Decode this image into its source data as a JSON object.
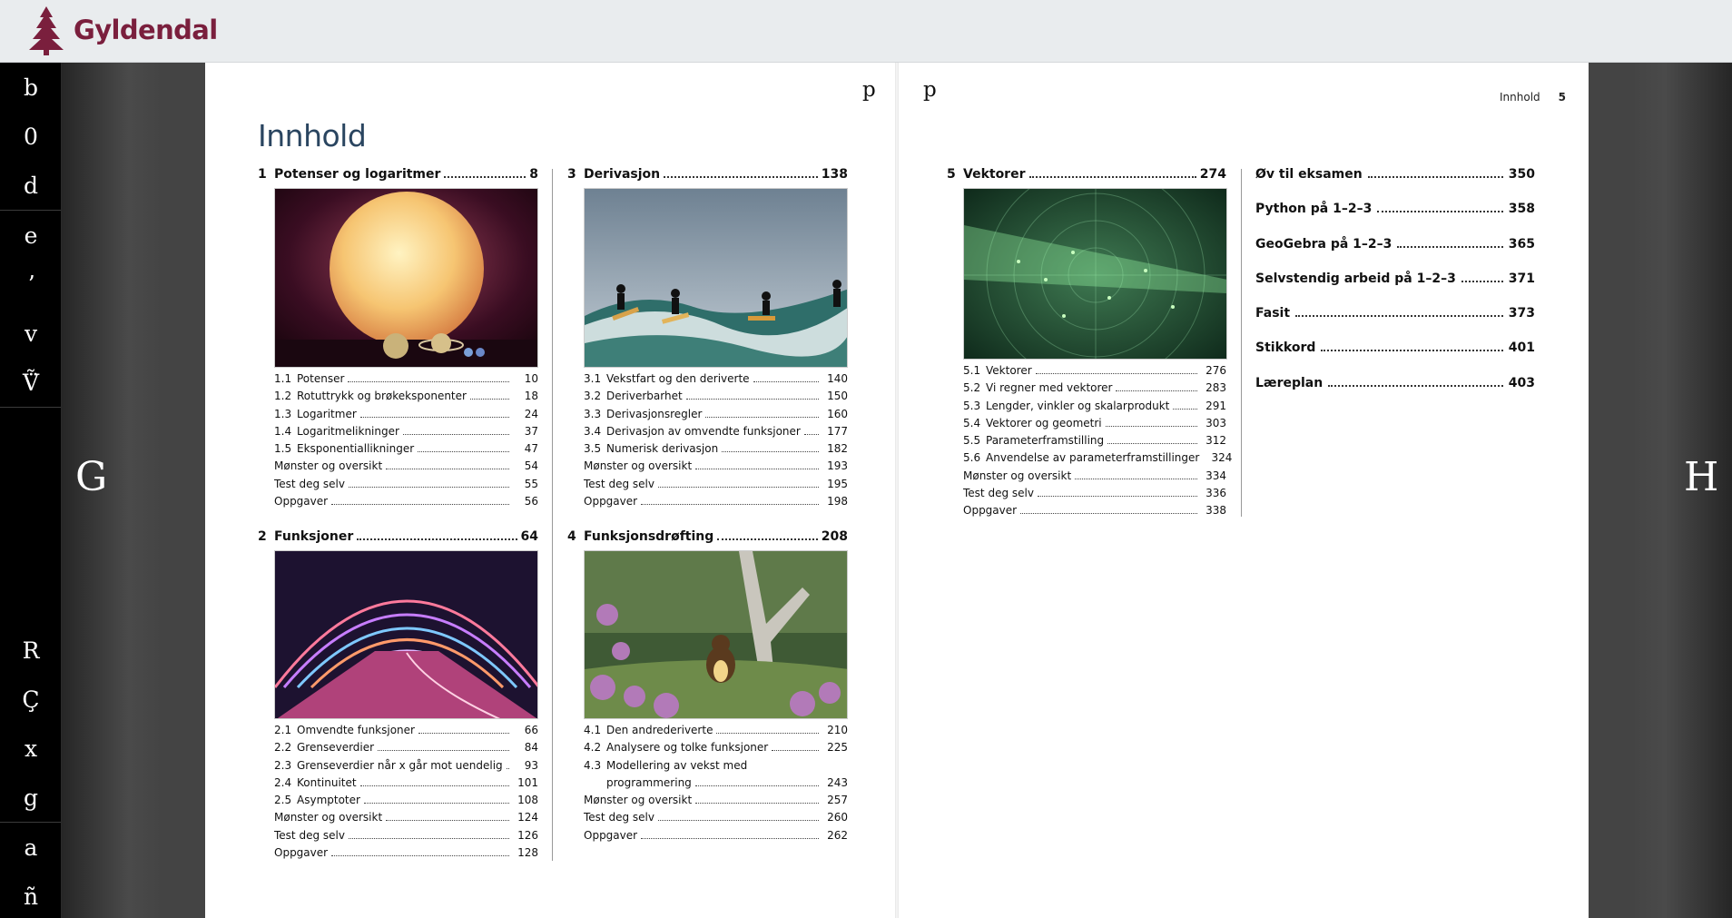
{
  "header": {
    "logo_text": "Gyldendal"
  },
  "sidebar": {
    "groups": [
      [
        "b",
        "0",
        "d"
      ],
      [
        "e",
        "ʼ",
        "v",
        "Ṽ̈"
      ],
      [
        "R",
        "Ç",
        "x",
        "g"
      ],
      [
        "a",
        "ñ"
      ]
    ]
  },
  "nav": {
    "prev": "G",
    "next": "H"
  },
  "page_corner_left": "p",
  "page_corner_right": "p",
  "running_head": {
    "section": "Innhold",
    "page": "5"
  },
  "title": "Innhold",
  "chapters": [
    {
      "num": "1",
      "title": "Potenser og logaritmer",
      "page": "8",
      "items": [
        {
          "num": "1.1",
          "label": "Potenser",
          "page": "10"
        },
        {
          "num": "1.2",
          "label": "Rotuttrykk og brøkeksponenter",
          "page": "18"
        },
        {
          "num": "1.3",
          "label": "Logaritmer",
          "page": "24"
        },
        {
          "num": "1.4",
          "label": "Logaritmelikninger",
          "page": "37"
        },
        {
          "num": "1.5",
          "label": "Eksponentiallikninger",
          "page": "47"
        },
        {
          "num": "",
          "label": "Mønster og oversikt",
          "page": "54"
        },
        {
          "num": "",
          "label": "Test deg selv",
          "page": "55"
        },
        {
          "num": "",
          "label": "Oppgaver",
          "page": "56"
        }
      ]
    },
    {
      "num": "2",
      "title": "Funksjoner",
      "page": "64",
      "items": [
        {
          "num": "2.1",
          "label": "Omvendte funksjoner",
          "page": "66"
        },
        {
          "num": "2.2",
          "label": "Grenseverdier",
          "page": "84"
        },
        {
          "num": "2.3",
          "label": "Grenseverdier når x går mot uendelig",
          "page": "93"
        },
        {
          "num": "2.4",
          "label": "Kontinuitet",
          "page": "101"
        },
        {
          "num": "2.5",
          "label": "Asymptoter",
          "page": "108"
        },
        {
          "num": "",
          "label": "Mønster og oversikt",
          "page": "124"
        },
        {
          "num": "",
          "label": "Test deg selv",
          "page": "126"
        },
        {
          "num": "",
          "label": "Oppgaver",
          "page": "128"
        }
      ]
    },
    {
      "num": "3",
      "title": "Derivasjon",
      "page": "138",
      "items": [
        {
          "num": "3.1",
          "label": "Vekstfart og den deriverte",
          "page": "140"
        },
        {
          "num": "3.2",
          "label": "Deriverbarhet",
          "page": "150"
        },
        {
          "num": "3.3",
          "label": "Derivasjonsregler",
          "page": "160"
        },
        {
          "num": "3.4",
          "label": "Derivasjon av omvendte funksjoner",
          "page": "177"
        },
        {
          "num": "3.5",
          "label": "Numerisk derivasjon",
          "page": "182"
        },
        {
          "num": "",
          "label": "Mønster og oversikt",
          "page": "193"
        },
        {
          "num": "",
          "label": "Test deg selv",
          "page": "195"
        },
        {
          "num": "",
          "label": "Oppgaver",
          "page": "198"
        }
      ]
    },
    {
      "num": "4",
      "title": "Funksjonsdrøfting",
      "page": "208",
      "items": [
        {
          "num": "4.1",
          "label": "Den andrederiverte",
          "page": "210"
        },
        {
          "num": "4.2",
          "label": "Analysere og tolke funksjoner",
          "page": "225"
        },
        {
          "num": "4.3",
          "label": "Modellering av vekst med",
          "label2": "programmering",
          "page": "243"
        },
        {
          "num": "",
          "label": "Mønster og oversikt",
          "page": "257"
        },
        {
          "num": "",
          "label": "Test deg selv",
          "page": "260"
        },
        {
          "num": "",
          "label": "Oppgaver",
          "page": "262"
        }
      ]
    },
    {
      "num": "5",
      "title": "Vektorer",
      "page": "274",
      "items": [
        {
          "num": "5.1",
          "label": "Vektorer",
          "page": "276"
        },
        {
          "num": "5.2",
          "label": "Vi regner med vektorer",
          "page": "283"
        },
        {
          "num": "5.3",
          "label": "Lengder, vinkler og skalarprodukt",
          "page": "291"
        },
        {
          "num": "5.4",
          "label": "Vektorer og geometri",
          "page": "303"
        },
        {
          "num": "5.5",
          "label": "Parameterframstilling",
          "page": "312"
        },
        {
          "num": "5.6",
          "label": "Anvendelse av parameterframstillinger",
          "page": "324"
        },
        {
          "num": "",
          "label": "Mønster og oversikt",
          "page": "334"
        },
        {
          "num": "",
          "label": "Test deg selv",
          "page": "336"
        },
        {
          "num": "",
          "label": "Oppgaver",
          "page": "338"
        }
      ]
    }
  ],
  "extras": [
    {
      "label": "Øv til eksamen",
      "page": "350"
    },
    {
      "label": "Python på 1–2–3",
      "page": "358"
    },
    {
      "label": "GeoGebra på 1–2–3",
      "page": "365"
    },
    {
      "label": "Selvstendig arbeid på 1–2–3",
      "page": "371"
    },
    {
      "label": "Fasit",
      "page": "373"
    },
    {
      "label": "Stikkord",
      "page": "401"
    },
    {
      "label": "Læreplan",
      "page": "403"
    }
  ],
  "colors": {
    "brand": "#7a1f3d",
    "title": "#2a4560",
    "sidebar": "#000000",
    "header": "#e9ecee"
  }
}
